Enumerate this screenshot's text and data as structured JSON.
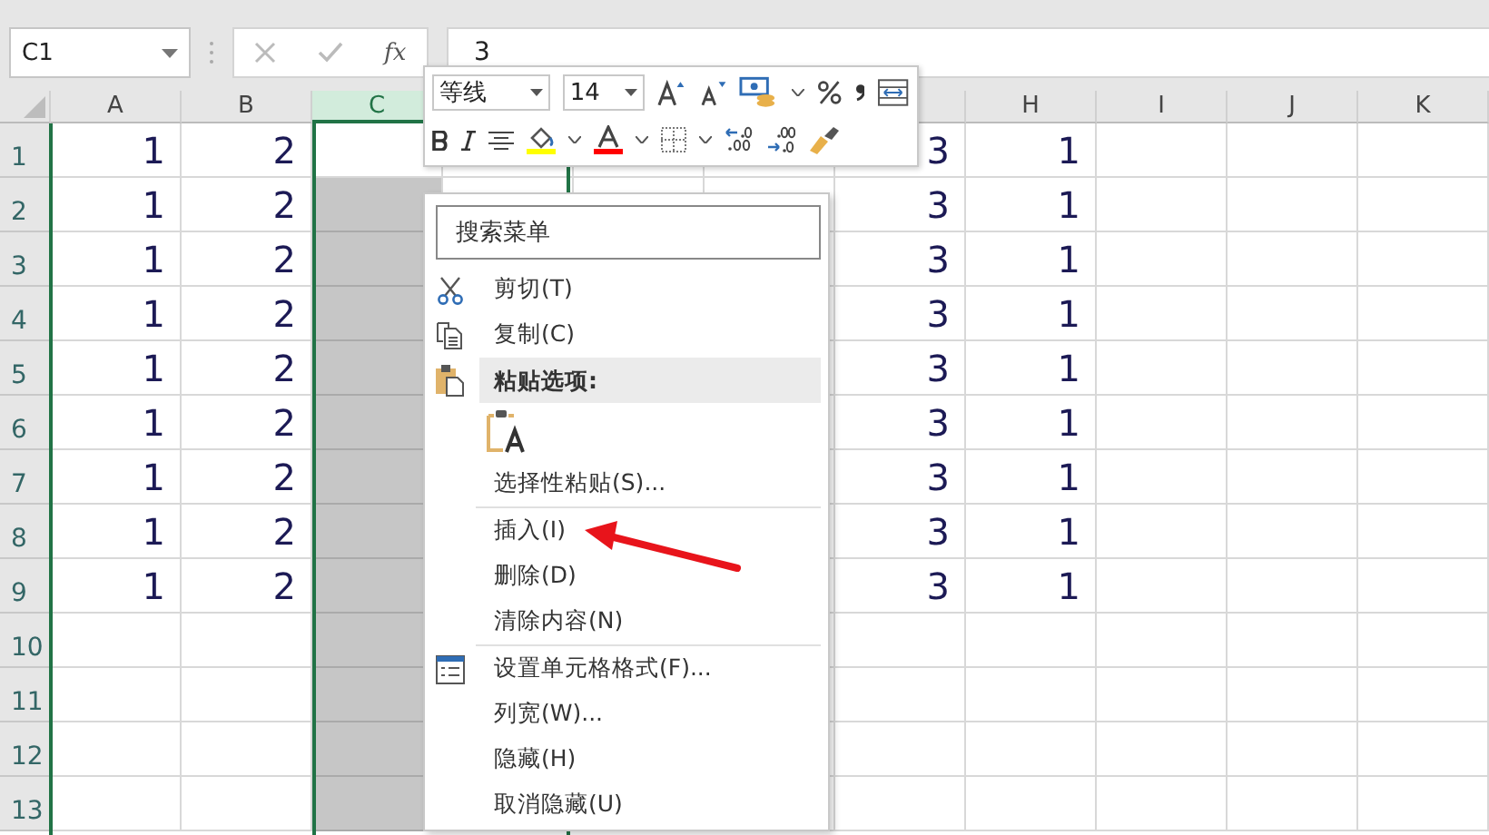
{
  "formula_bar": {
    "name_box": "C1",
    "fx": "fx",
    "value": "3"
  },
  "columns": [
    {
      "kind": "header",
      "label": "A",
      "selected": false
    },
    {
      "kind": "header",
      "label": "B",
      "selected": false
    },
    {
      "kind": "header",
      "label": "C",
      "selected": true
    },
    {
      "kind": "covered"
    },
    {
      "kind": "covered"
    },
    {
      "kind": "covered"
    },
    {
      "kind": "blank"
    },
    {
      "kind": "header",
      "label": "H",
      "selected": false
    },
    {
      "kind": "header",
      "label": "I",
      "selected": false
    },
    {
      "kind": "header",
      "label": "J",
      "selected": false
    },
    {
      "kind": "header",
      "label": "K",
      "selected": false
    }
  ],
  "rows": [
    {
      "header": "1",
      "active": true,
      "cells": [
        "1",
        "2",
        null,
        null,
        null,
        null,
        "3",
        "1",
        null,
        null,
        null
      ]
    },
    {
      "header": "2",
      "active": false,
      "cells": [
        "1",
        "2",
        null,
        null,
        null,
        null,
        "3",
        "1",
        null,
        null,
        null
      ]
    },
    {
      "header": "3",
      "active": false,
      "cells": [
        "1",
        "2",
        null,
        null,
        null,
        null,
        "3",
        "1",
        null,
        null,
        null
      ]
    },
    {
      "header": "4",
      "active": false,
      "cells": [
        "1",
        "2",
        null,
        null,
        null,
        null,
        "3",
        "1",
        null,
        null,
        null
      ]
    },
    {
      "header": "5",
      "active": false,
      "cells": [
        "1",
        "2",
        null,
        null,
        null,
        null,
        "3",
        "1",
        null,
        null,
        null
      ]
    },
    {
      "header": "6",
      "active": false,
      "cells": [
        "1",
        "2",
        null,
        null,
        null,
        null,
        "3",
        "1",
        null,
        null,
        null
      ]
    },
    {
      "header": "7",
      "active": false,
      "cells": [
        "1",
        "2",
        null,
        null,
        null,
        null,
        "3",
        "1",
        null,
        null,
        null
      ]
    },
    {
      "header": "8",
      "active": false,
      "cells": [
        "1",
        "2",
        null,
        null,
        null,
        null,
        "3",
        "1",
        null,
        null,
        null
      ]
    },
    {
      "header": "9",
      "active": false,
      "cells": [
        "1",
        "2",
        null,
        null,
        null,
        null,
        "3",
        "1",
        null,
        null,
        null
      ]
    },
    {
      "header": "10",
      "active": false,
      "cells": [
        null,
        null,
        null,
        null,
        null,
        null,
        null,
        null,
        null,
        null,
        null
      ]
    },
    {
      "header": "11",
      "active": false,
      "cells": [
        null,
        null,
        null,
        null,
        null,
        null,
        null,
        null,
        null,
        null,
        null
      ]
    },
    {
      "header": "12",
      "active": false,
      "cells": [
        null,
        null,
        null,
        null,
        null,
        null,
        null,
        null,
        null,
        null,
        null
      ]
    },
    {
      "header": "13",
      "active": false,
      "cells": [
        null,
        null,
        null,
        null,
        null,
        null,
        null,
        null,
        null,
        null,
        null
      ]
    }
  ],
  "mini_toolbar": {
    "font": "等线",
    "size": "14"
  },
  "context_menu": {
    "search": {
      "placeholder": "搜索菜单"
    },
    "items": [
      {
        "kind": "cut",
        "label": "剪切(T)"
      },
      {
        "kind": "copy",
        "label": "复制(C)"
      },
      {
        "kind": "pasteheader",
        "label": "粘贴选项:"
      },
      {
        "kind": "pasteoptions"
      },
      {
        "kind": "command",
        "label": "选择性粘贴(S)..."
      },
      {
        "kind": "divider"
      },
      {
        "kind": "command",
        "label": "插入(I)"
      },
      {
        "kind": "command",
        "label": "删除(D)"
      },
      {
        "kind": "command",
        "label": "清除内容(N)"
      },
      {
        "kind": "divider"
      },
      {
        "kind": "format",
        "label": "设置单元格格式(F)..."
      },
      {
        "kind": "command",
        "label": "列宽(W)..."
      },
      {
        "kind": "command",
        "label": "隐藏(H)"
      },
      {
        "kind": "command",
        "label": "取消隐藏(U)"
      }
    ]
  }
}
